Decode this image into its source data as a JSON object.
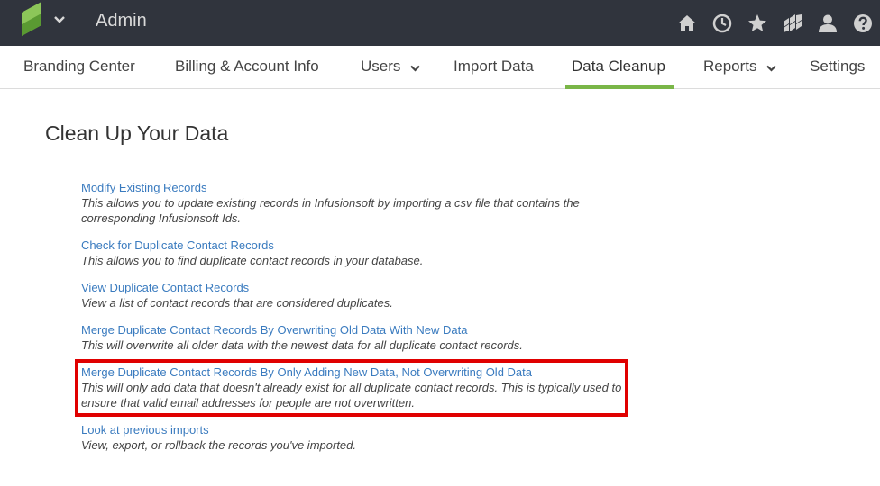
{
  "header": {
    "app_title": "Admin",
    "logo_colors": [
      "#7ab648",
      "#5a9a32"
    ],
    "icons": [
      "home-icon",
      "clock-icon",
      "star-icon",
      "apps-icon",
      "user-icon",
      "help-icon"
    ]
  },
  "nav": {
    "items": [
      {
        "label": "Branding Center",
        "has_dropdown": false
      },
      {
        "label": "Billing & Account Info",
        "has_dropdown": false
      },
      {
        "label": "Users",
        "has_dropdown": true
      },
      {
        "label": "Import Data",
        "has_dropdown": false
      },
      {
        "label": "Data Cleanup",
        "has_dropdown": false,
        "active": true
      },
      {
        "label": "Reports",
        "has_dropdown": true
      },
      {
        "label": "Settings",
        "has_dropdown": false
      }
    ],
    "active_color": "#7ab648"
  },
  "page": {
    "title": "Clean Up Your Data",
    "entries": [
      {
        "link": "Modify Existing Records",
        "description": "This allows you to update existing records in Infusionsoft by importing a csv file that contains the corresponding Infusionsoft Ids."
      },
      {
        "link": "Check for Duplicate Contact Records",
        "description": "This allows you to find duplicate contact records in your database."
      },
      {
        "link": "View Duplicate Contact Records",
        "description": "View a list of contact records that are considered duplicates."
      },
      {
        "link": "Merge Duplicate Contact Records By Overwriting Old Data With New Data",
        "description": "This will overwrite all older data with the newest data for all duplicate contact records."
      },
      {
        "link": "Merge Duplicate Contact Records By Only Adding New Data, Not Overwriting Old Data",
        "description": "This will only add data that doesn't already exist for all duplicate contact records. This is typically used to ensure that valid email addresses for people are not overwritten.",
        "highlighted": true
      },
      {
        "link": "Look at previous imports",
        "description": "View, export, or rollback the records you've imported."
      }
    ],
    "highlight_color": "#e00000",
    "link_color": "#3a7bbf"
  }
}
